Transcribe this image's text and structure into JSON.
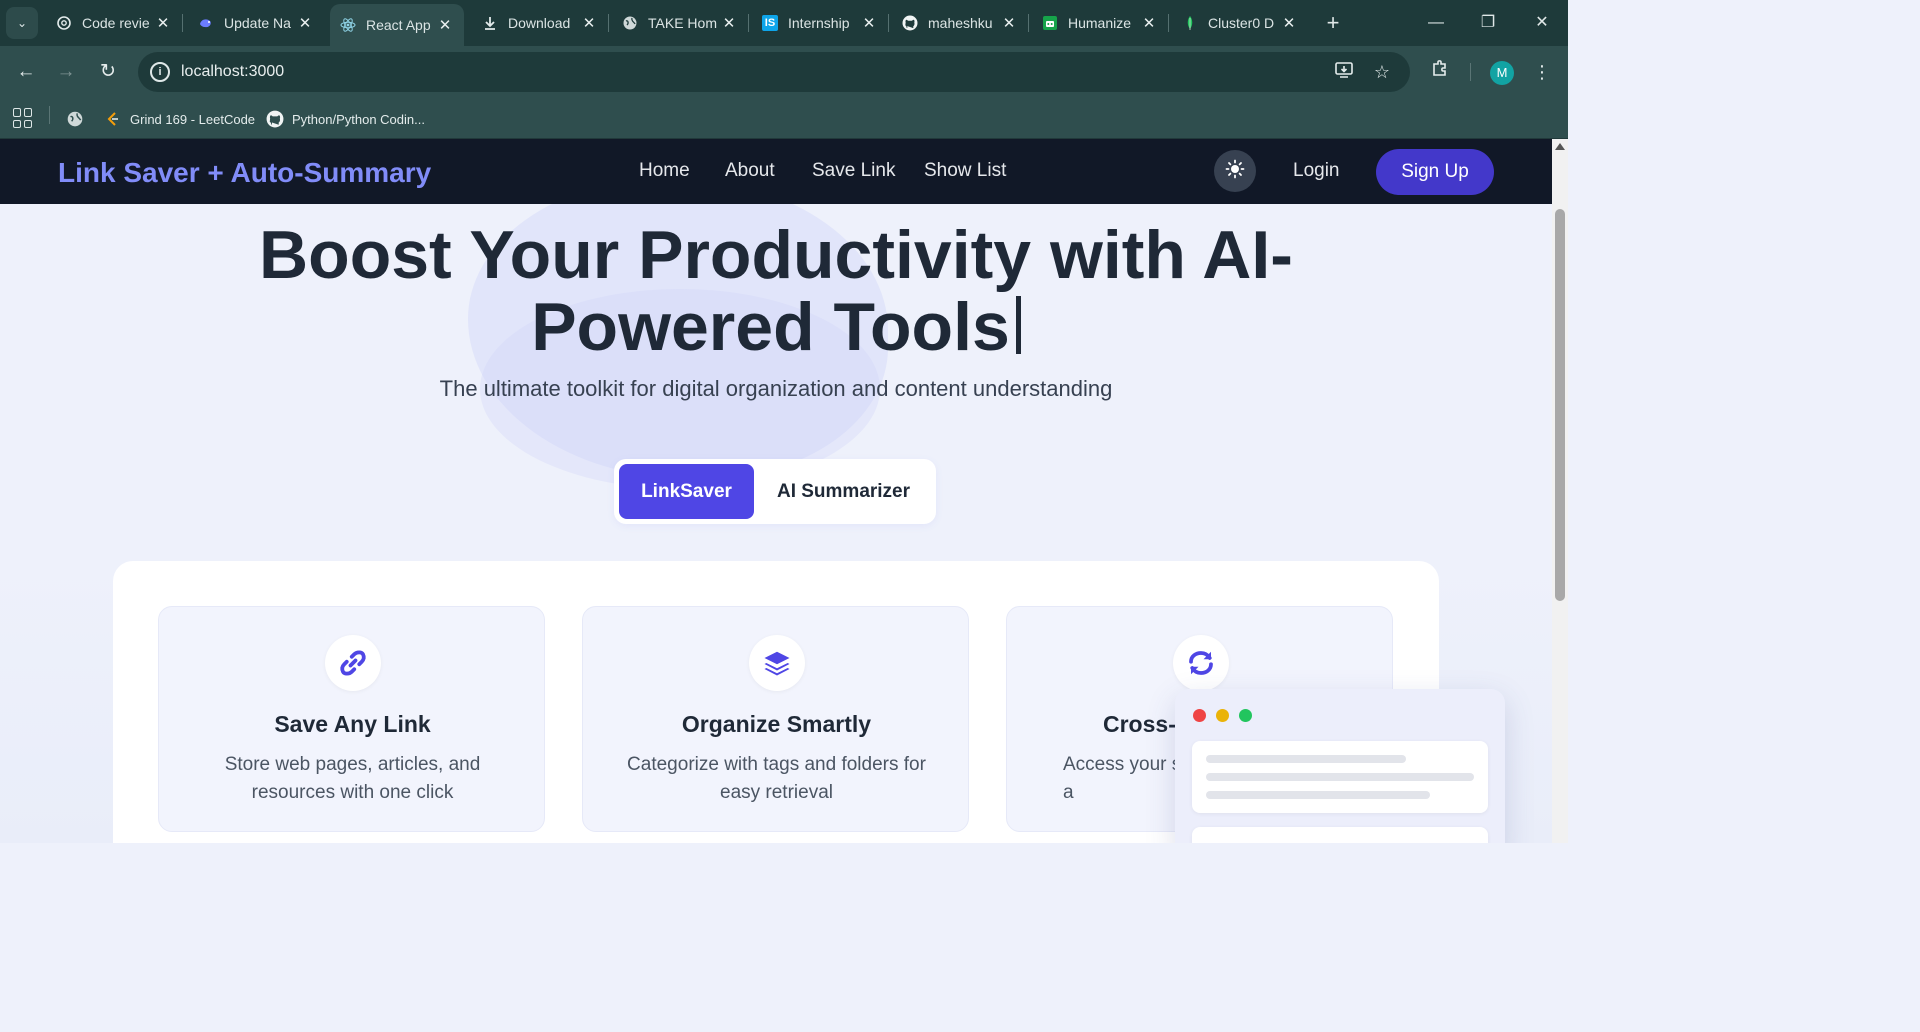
{
  "browser": {
    "tabs": [
      {
        "title": "Code revie",
        "icon": "openai-icon",
        "active": false
      },
      {
        "title": "Update Na",
        "icon": "deepseek-icon",
        "active": false
      },
      {
        "title": "React App",
        "icon": "react-icon",
        "active": true
      },
      {
        "title": "Download",
        "icon": "download-icon",
        "active": false
      },
      {
        "title": "TAKE Hom",
        "icon": "globe-icon",
        "active": false
      },
      {
        "title": "Internship",
        "icon": "internshala-icon",
        "active": false
      },
      {
        "title": "maheshku",
        "icon": "github-icon",
        "active": false
      },
      {
        "title": "Humanize",
        "icon": "humanize-icon",
        "active": false
      },
      {
        "title": "Cluster0 D",
        "icon": "mongodb-leaf-icon",
        "active": false
      }
    ],
    "url": "localhost:3000",
    "profile_initial": "M",
    "bookmarks": [
      {
        "label": "Grind 169 - LeetCode",
        "icon": "leetcode-icon"
      },
      {
        "label": "Python/Python Codin...",
        "icon": "github-icon"
      }
    ]
  },
  "navbar": {
    "brand": "Link Saver + Auto-Summary",
    "links": [
      "Home",
      "About",
      "Save Link",
      "Show List"
    ],
    "login": "Login",
    "signup": "Sign Up"
  },
  "hero": {
    "title_line1": "Boost Your Productivity with AI-",
    "title_line2": "Powered Tools",
    "subtitle": "The ultimate toolkit for digital organization and content understanding"
  },
  "toggle": {
    "options": [
      "LinkSaver",
      "AI Summarizer"
    ],
    "selected": "LinkSaver"
  },
  "features": [
    {
      "icon": "link-icon",
      "title": "Save Any Link",
      "desc": "Store web pages, articles, and resources with one click"
    },
    {
      "icon": "layers-icon",
      "title": "Organize Smartly",
      "desc": "Categorize with tags and folders for easy retrieval"
    },
    {
      "icon": "sync-icon",
      "title": "Cross-I",
      "desc": "Access your sa a"
    }
  ],
  "colors": {
    "accent": "#4f46e5",
    "brand_text": "#818cf8",
    "navbar_bg": "#111827",
    "browser_frame": "#1e3a3a"
  }
}
